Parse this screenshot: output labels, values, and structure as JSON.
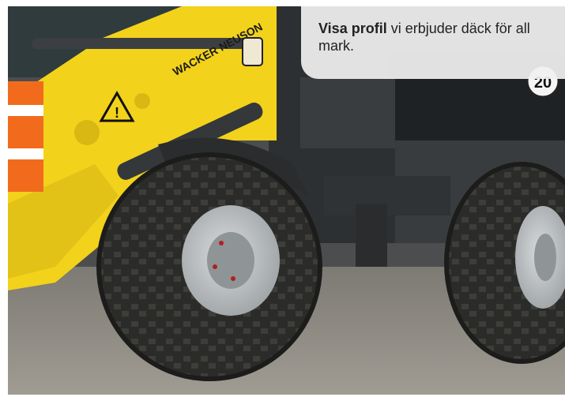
{
  "photo": {
    "subject": "Wheel loader with large off-road tyres",
    "brand_decal": "WACKER NEUSON",
    "speed_sign": "20",
    "colors": {
      "body_yellow": "#f2d21b",
      "tyre": "#2a2a28",
      "rim": "#b9bec0",
      "cab": "#2d3033"
    }
  },
  "caption": {
    "link_text": "Visa profil",
    "body_text": " vi erbjuder däck för all mark."
  }
}
